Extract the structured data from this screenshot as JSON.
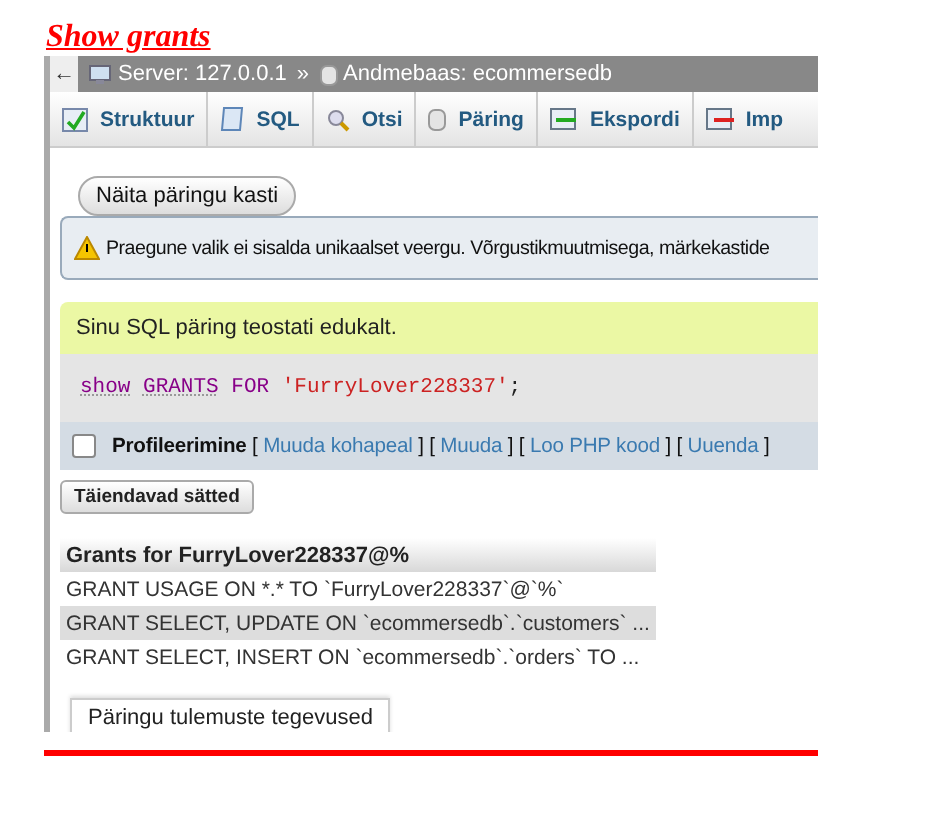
{
  "heading": "Show grants",
  "breadcrumb": {
    "back": "←",
    "separator": "»",
    "items": [
      {
        "text": "Server: 127.0.0.1",
        "kind": "server"
      },
      {
        "text": "Andmebaas: ecommersedb",
        "kind": "database"
      }
    ]
  },
  "tabs": [
    {
      "label": "Struktuur",
      "kind": "structure"
    },
    {
      "label": "SQL",
      "kind": "sql"
    },
    {
      "label": "Otsi",
      "kind": "search"
    },
    {
      "label": "Päring",
      "kind": "query"
    },
    {
      "label": "Ekspordi",
      "kind": "export"
    },
    {
      "label": "Imp",
      "kind": "import"
    }
  ],
  "show_query_button": "Näita päringu kasti",
  "warning": "Praegune valik ei sisalda unikaalset veergu. Võrgustikmuutmisega, märkekastide",
  "success": "Sinu SQL päring teostati edukalt.",
  "query": [
    {
      "text": "show",
      "kind": "function"
    },
    {
      "text": "GRANTS",
      "kind": "function"
    },
    {
      "text": "FOR",
      "kind": "keyword"
    },
    {
      "text": "'FurryLover228337'",
      "kind": "string"
    },
    {
      "text": ";",
      "kind": "punct"
    }
  ],
  "profiling": {
    "checked": false,
    "label": "Profileerimine",
    "brackets": [
      "[",
      "]"
    ],
    "links": [
      "Muuda kohapeal",
      "Muuda",
      "Loo PHP kood",
      "Uuenda"
    ]
  },
  "options_button": "Täiendavad sätted",
  "results": {
    "columns": [
      "Grants for FurryLover228337@%"
    ],
    "rows": [
      {
        "cells": [
          "GRANT USAGE ON *.* TO `FurryLover228337`@`%`"
        ],
        "highlighted": false
      },
      {
        "cells": [
          "GRANT SELECT, UPDATE ON `ecommersedb`.`customers` ..."
        ],
        "highlighted": true
      },
      {
        "cells": [
          "GRANT SELECT, INSERT ON `ecommersedb`.`orders` TO ..."
        ],
        "highlighted": false
      }
    ]
  },
  "actions_tab": "Päringu tulemuste tegevused"
}
